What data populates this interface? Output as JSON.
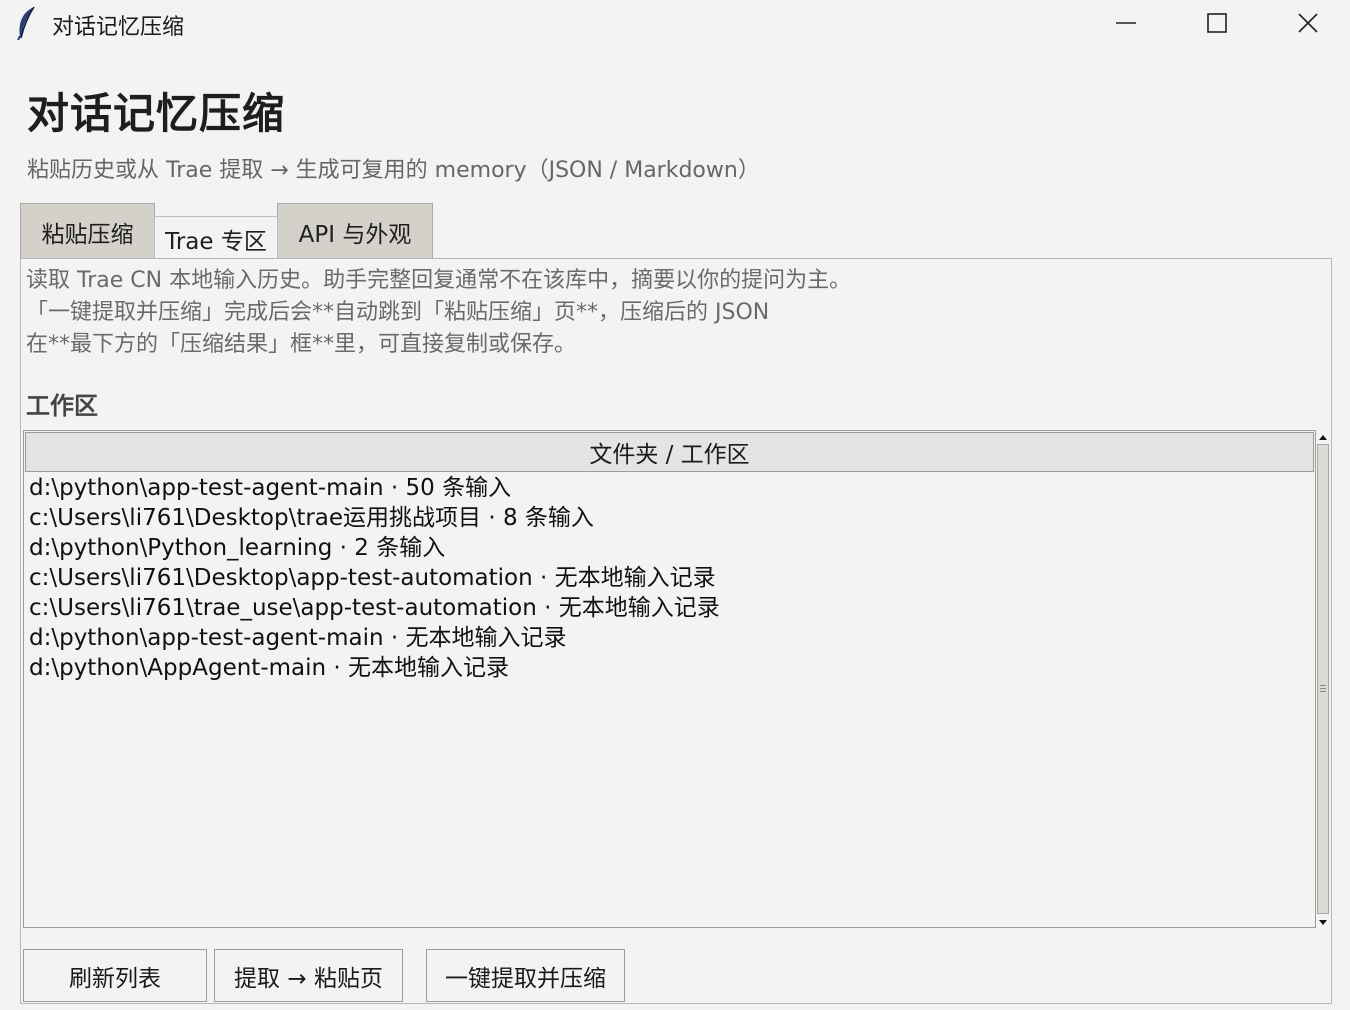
{
  "window": {
    "title": "对话记忆压缩",
    "icon": "feather-icon",
    "controls": [
      "minimize-icon",
      "maximize-icon",
      "close-icon"
    ]
  },
  "header": {
    "title": "对话记忆压缩",
    "subtitle": "粘贴历史或从 Trae 提取 → 生成可复用的 memory（JSON / Markdown）"
  },
  "tabs": [
    {
      "label": "粘贴压缩",
      "active": false
    },
    {
      "label": "Trae 专区",
      "active": true
    },
    {
      "label": "API 与外观",
      "active": false
    }
  ],
  "panel": {
    "description": [
      "读取 Trae CN 本地输入历史。助手完整回复通常不在该库中，摘要以你的提问为主。",
      "「一键提取并压缩」完成后会**自动跳到「粘贴压缩」页**，压缩后的 JSON",
      "在**最下方的「压缩结果」框**里，可直接复制或保存。"
    ],
    "section_label": "工作区",
    "tree": {
      "column_header": "文件夹 / 工作区",
      "rows": [
        "d:\\python\\app-test-agent-main · 50 条输入",
        "c:\\Users\\li761\\Desktop\\trae运用挑战项目 · 8 条输入",
        "d:\\python\\Python_learning · 2 条输入",
        "c:\\Users\\li761\\Desktop\\app-test-automation · 无本地输入记录",
        "c:\\Users\\li761\\trae_use\\app-test-automation · 无本地输入记录",
        "d:\\python\\app-test-agent-main · 无本地输入记录",
        "d:\\python\\AppAgent-main · 无本地输入记录"
      ]
    },
    "buttons": {
      "refresh": "刷新列表",
      "extract": "提取 → 粘贴页",
      "oneclick": "一键提取并压缩"
    }
  },
  "colors": {
    "background": "#f3f3f3",
    "tab_inactive": "#d4d1ca",
    "subtitle_text": "#666666"
  }
}
